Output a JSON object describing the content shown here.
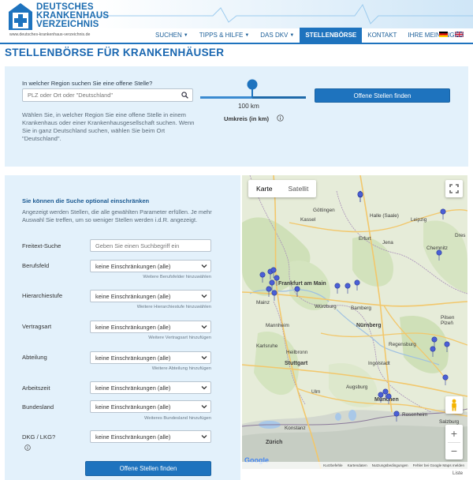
{
  "header": {
    "logo_line1": "DEUTSCHES",
    "logo_line2": "KRANKENHAUS",
    "logo_line3": "VERZEICHNIS",
    "logo_url": "www.deutsches-krankenhaus-verzeichnis.de",
    "nav": [
      {
        "label": "SUCHEN",
        "dropdown": true
      },
      {
        "label": "TIPPS & HILFE",
        "dropdown": true
      },
      {
        "label": "DAS DKV",
        "dropdown": true
      },
      {
        "label": "STELLENBÖRSE",
        "active": true
      },
      {
        "label": "KONTAKT"
      },
      {
        "label": "IHRE MEINUNG"
      }
    ],
    "accent": "#1e73be"
  },
  "page_title": "STELLENBÖRSE FÜR KRANKENHÄUSER",
  "region": {
    "question": "In welcher Region suchen Sie eine offene Stelle?",
    "placeholder": "PLZ oder Ort oder \"Deutschland\"",
    "help": "Wählen Sie, in welcher Region Sie eine offene Stelle in einem Krankenhaus oder einer Krankenhausgesellschaft suchen. Wenn Sie in ganz Deutschland suchen, wählen Sie beim Ort \"Deutschland\".",
    "radius_value": "100 km",
    "radius_fraction": 0.5,
    "radius_label": "Umkreis (in km)",
    "button": "Offene Stellen finden"
  },
  "filters": {
    "title": "Sie können die Suche optional einschränken",
    "description": "Angezeigt werden Stellen, die alle gewählten Parameter erfüllen. Je mehr Auswahl Sie treffen, um so weniger Stellen werden i.d.R. angezeigt.",
    "freetext_label": "Freitext-Suche",
    "freetext_placeholder": "Geben Sie einen Suchbegriff ein",
    "rows": [
      {
        "label": "Berufsfeld",
        "value": "keine Einschränkungen (alle)",
        "more": "Weitere Berufsfelder hinzuwählen"
      },
      {
        "label": "Hierarchiestufe",
        "value": "keine Einschränkungen (alle)",
        "more": "Weitere Hierarchiestufe hinzuwählen"
      },
      {
        "label": "Vertragsart",
        "value": "keine Einschränkungen (alle)",
        "more": "Weitere Vertragsart hinzufügen"
      },
      {
        "label": "Abteilung",
        "value": "keine Einschränkungen (alle)",
        "more": "Weitere Abteilung hinzufügen"
      },
      {
        "label": "Arbeitszeit",
        "value": "keine Einschränkungen (alle)",
        "more": ""
      },
      {
        "label": "Bundesland",
        "value": "keine Einschränkungen (alle)",
        "more": "Weiteres Bundesland hinzufügen"
      },
      {
        "label": "DKG / LKG?",
        "value": "keine Einschränkungen (alle)",
        "more": ""
      }
    ],
    "button": "Offene Stellen finden"
  },
  "map": {
    "toggle_map": "Karte",
    "toggle_sat": "Satellit",
    "cities": [
      "Göttingen",
      "Halle (Saale)",
      "Leipzig",
      "Kassel",
      "Erfurt",
      "Jena",
      "Chemnitz",
      "Dres",
      "Frankfurt am Main",
      "Mainz",
      "Würzburg",
      "Bamberg",
      "Mannheim",
      "Nürnberg",
      "Heilbronn",
      "Karlsruhe",
      "Stuttgart",
      "Regensburg",
      "Ingolstadt",
      "Augsburg",
      "München",
      "Ulm",
      "Konstanz",
      "Zürich",
      "Salzburg",
      "Rosenheim",
      "Pilsen",
      "Plzeň"
    ],
    "footer": [
      "Kurzbefehle",
      "Kartendaten",
      "Nutzungsbedingungen",
      "Fehler bei Google Maps melden"
    ],
    "google": "Google",
    "liste": "Liste"
  }
}
